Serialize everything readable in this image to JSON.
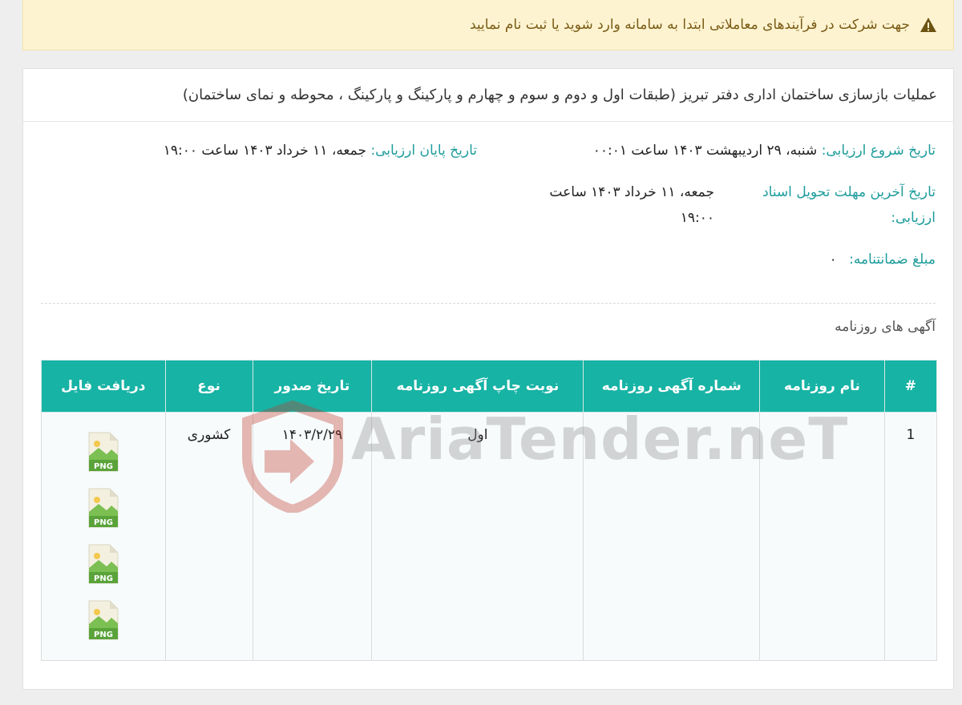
{
  "alert": {
    "icon": "warning-icon",
    "text": "جهت شرکت در فرآیندهای معاملاتی ابتدا به سامانه وارد شوید یا ثبت نام نمایید"
  },
  "tender": {
    "title": "عملیات بازسازی ساختمان اداری دفتر تبریز (طبقات اول و دوم و سوم و چهارم و پارکینگ و پارکینگ ، محوطه و نمای ساختمان)"
  },
  "details": {
    "start_label": "تاریخ شروع ارزیابی:",
    "start_value": "شنبه، ۲۹ اردیبهشت ۱۴۰۳ ساعت ۰۰:۰۱",
    "end_label": "تاریخ پایان ارزیابی:",
    "end_value": "جمعه، ۱۱ خرداد ۱۴۰۳ ساعت ۱۹:۰۰",
    "deadline_label": "تاریخ آخرین مهلت تحویل اسناد ارزیابی:",
    "deadline_value": "جمعه، ۱۱ خرداد ۱۴۰۳ ساعت ۱۹:۰۰",
    "guarantee_label": "مبلغ ضمانتنامه:",
    "guarantee_value": "۰"
  },
  "newspapers": {
    "title": "آگهی های روزنامه",
    "headers": [
      "#",
      "نام روزنامه",
      "شماره آگهی روزنامه",
      "نوبت چاپ آگهی روزنامه",
      "تاریخ صدور",
      "نوع",
      "دریافت فایل"
    ],
    "rows": [
      {
        "index": "1",
        "paper_name": "",
        "ad_number": "",
        "print_round": "اول",
        "issue_date": "۱۴۰۳/۲/۲۹",
        "type": "کشوری",
        "files": [
          "PNG",
          "PNG",
          "PNG",
          "PNG"
        ]
      }
    ]
  },
  "watermark": {
    "text": "AriaTender.neT"
  },
  "colors": {
    "accent": "#17b3a5",
    "label": "#1f9c9c",
    "alert_bg": "#fdf3d1",
    "alert_text": "#7a5b14",
    "file_green": "#6db33f"
  }
}
